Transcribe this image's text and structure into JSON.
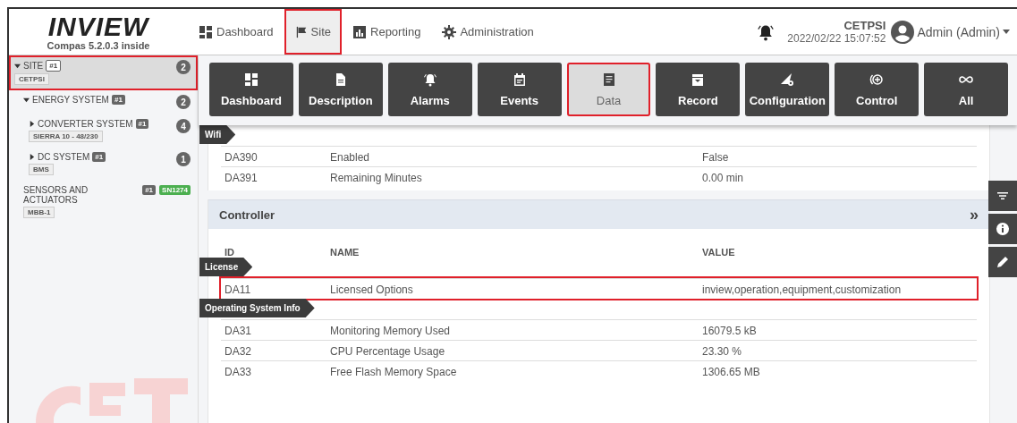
{
  "header": {
    "logo": "INVIEW",
    "version": "Compas 5.2.0.3 inside",
    "nav": [
      {
        "label": "Dashboard",
        "selected": false,
        "highlighted": false
      },
      {
        "label": "Site",
        "selected": true,
        "highlighted": true
      },
      {
        "label": "Reporting",
        "selected": false,
        "highlighted": false
      },
      {
        "label": "Administration",
        "selected": false,
        "highlighted": false
      }
    ],
    "site_name": "CETPSI",
    "datetime": "2022/02/22 15:07:52",
    "user": "Admin (Admin)"
  },
  "sidebar": {
    "tree": [
      {
        "label": "SITE",
        "tag": "#1",
        "sub": "CETPSI",
        "count": "2",
        "expanded": true,
        "selected": true,
        "highlighted": true,
        "children": [
          {
            "label": "ENERGY SYSTEM",
            "tag": "#1",
            "count": "2",
            "expanded": true,
            "selected": false,
            "highlighted": false,
            "children": [
              {
                "label": "CONVERTER SYSTEM",
                "tag": "#1",
                "sub": "SIERRA 10 - 48/230",
                "count": "4",
                "expanded": false,
                "selected": false,
                "highlighted": false
              },
              {
                "label": "DC SYSTEM",
                "tag": "#1",
                "sub": "BMS",
                "count": "1",
                "expanded": false,
                "selected": false,
                "highlighted": false
              }
            ]
          },
          {
            "label": "SENSORS AND ACTUATORS",
            "tag": "#1",
            "serial": "SN1274",
            "sub": "MBB-1",
            "selected": false,
            "highlighted": false
          }
        ]
      }
    ]
  },
  "toolbar": [
    {
      "label": "Dashboard",
      "selected": false,
      "highlighted": false
    },
    {
      "label": "Description",
      "selected": false,
      "highlighted": false
    },
    {
      "label": "Alarms",
      "selected": false,
      "highlighted": false
    },
    {
      "label": "Events",
      "selected": false,
      "highlighted": false
    },
    {
      "label": "Data",
      "selected": true,
      "highlighted": true
    },
    {
      "label": "Record",
      "selected": false,
      "highlighted": false
    },
    {
      "label": "Configuration",
      "selected": false,
      "highlighted": false
    },
    {
      "label": "Control",
      "selected": false,
      "highlighted": false
    },
    {
      "label": "All",
      "selected": false,
      "highlighted": false
    }
  ],
  "content": {
    "top_group": {
      "label": "Wifi",
      "rows": [
        {
          "id": "DA390",
          "name": "Enabled",
          "value": "False",
          "highlighted": false
        },
        {
          "id": "DA391",
          "name": "Remaining Minutes",
          "value": "0.00 min",
          "highlighted": false
        }
      ]
    },
    "panel": {
      "title": "Controller",
      "expand_icon": "»",
      "columns": [
        "ID",
        "NAME",
        "VALUE"
      ],
      "groups": [
        {
          "label": "License",
          "rows": [
            {
              "id": "DA11",
              "name": "Licensed Options",
              "value": "inview,operation,equipment,customization",
              "highlighted": true
            }
          ]
        },
        {
          "label": "Operating System Info",
          "rows": [
            {
              "id": "DA31",
              "name": "Monitoring Memory Used",
              "value": "16079.5 kB",
              "highlighted": false
            },
            {
              "id": "DA32",
              "name": "CPU Percentage Usage",
              "value": "23.30 %",
              "highlighted": false
            },
            {
              "id": "DA33",
              "name": "Free Flash Memory Space",
              "value": "1306.65 MB",
              "highlighted": false
            }
          ]
        }
      ]
    }
  }
}
